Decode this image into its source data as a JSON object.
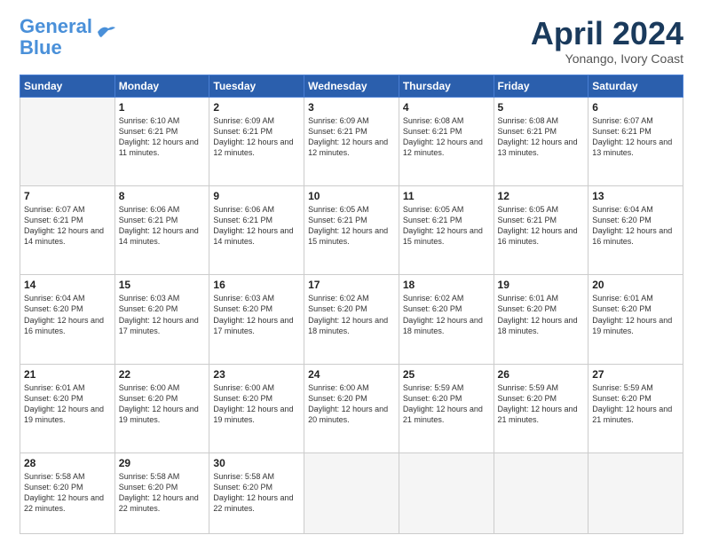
{
  "header": {
    "logo_line1": "General",
    "logo_line2": "Blue",
    "month": "April 2024",
    "location": "Yonango, Ivory Coast"
  },
  "weekdays": [
    "Sunday",
    "Monday",
    "Tuesday",
    "Wednesday",
    "Thursday",
    "Friday",
    "Saturday"
  ],
  "weeks": [
    [
      {
        "day": "",
        "empty": true
      },
      {
        "day": "1",
        "sunrise": "6:10 AM",
        "sunset": "6:21 PM",
        "daylight": "12 hours and 11 minutes."
      },
      {
        "day": "2",
        "sunrise": "6:09 AM",
        "sunset": "6:21 PM",
        "daylight": "12 hours and 12 minutes."
      },
      {
        "day": "3",
        "sunrise": "6:09 AM",
        "sunset": "6:21 PM",
        "daylight": "12 hours and 12 minutes."
      },
      {
        "day": "4",
        "sunrise": "6:08 AM",
        "sunset": "6:21 PM",
        "daylight": "12 hours and 12 minutes."
      },
      {
        "day": "5",
        "sunrise": "6:08 AM",
        "sunset": "6:21 PM",
        "daylight": "12 hours and 13 minutes."
      },
      {
        "day": "6",
        "sunrise": "6:07 AM",
        "sunset": "6:21 PM",
        "daylight": "12 hours and 13 minutes."
      }
    ],
    [
      {
        "day": "7",
        "sunrise": "6:07 AM",
        "sunset": "6:21 PM",
        "daylight": "12 hours and 14 minutes."
      },
      {
        "day": "8",
        "sunrise": "6:06 AM",
        "sunset": "6:21 PM",
        "daylight": "12 hours and 14 minutes."
      },
      {
        "day": "9",
        "sunrise": "6:06 AM",
        "sunset": "6:21 PM",
        "daylight": "12 hours and 14 minutes."
      },
      {
        "day": "10",
        "sunrise": "6:05 AM",
        "sunset": "6:21 PM",
        "daylight": "12 hours and 15 minutes."
      },
      {
        "day": "11",
        "sunrise": "6:05 AM",
        "sunset": "6:21 PM",
        "daylight": "12 hours and 15 minutes."
      },
      {
        "day": "12",
        "sunrise": "6:05 AM",
        "sunset": "6:21 PM",
        "daylight": "12 hours and 16 minutes."
      },
      {
        "day": "13",
        "sunrise": "6:04 AM",
        "sunset": "6:20 PM",
        "daylight": "12 hours and 16 minutes."
      }
    ],
    [
      {
        "day": "14",
        "sunrise": "6:04 AM",
        "sunset": "6:20 PM",
        "daylight": "12 hours and 16 minutes."
      },
      {
        "day": "15",
        "sunrise": "6:03 AM",
        "sunset": "6:20 PM",
        "daylight": "12 hours and 17 minutes."
      },
      {
        "day": "16",
        "sunrise": "6:03 AM",
        "sunset": "6:20 PM",
        "daylight": "12 hours and 17 minutes."
      },
      {
        "day": "17",
        "sunrise": "6:02 AM",
        "sunset": "6:20 PM",
        "daylight": "12 hours and 18 minutes."
      },
      {
        "day": "18",
        "sunrise": "6:02 AM",
        "sunset": "6:20 PM",
        "daylight": "12 hours and 18 minutes."
      },
      {
        "day": "19",
        "sunrise": "6:01 AM",
        "sunset": "6:20 PM",
        "daylight": "12 hours and 18 minutes."
      },
      {
        "day": "20",
        "sunrise": "6:01 AM",
        "sunset": "6:20 PM",
        "daylight": "12 hours and 19 minutes."
      }
    ],
    [
      {
        "day": "21",
        "sunrise": "6:01 AM",
        "sunset": "6:20 PM",
        "daylight": "12 hours and 19 minutes."
      },
      {
        "day": "22",
        "sunrise": "6:00 AM",
        "sunset": "6:20 PM",
        "daylight": "12 hours and 19 minutes."
      },
      {
        "day": "23",
        "sunrise": "6:00 AM",
        "sunset": "6:20 PM",
        "daylight": "12 hours and 19 minutes."
      },
      {
        "day": "24",
        "sunrise": "6:00 AM",
        "sunset": "6:20 PM",
        "daylight": "12 hours and 20 minutes."
      },
      {
        "day": "25",
        "sunrise": "5:59 AM",
        "sunset": "6:20 PM",
        "daylight": "12 hours and 21 minutes."
      },
      {
        "day": "26",
        "sunrise": "5:59 AM",
        "sunset": "6:20 PM",
        "daylight": "12 hours and 21 minutes."
      },
      {
        "day": "27",
        "sunrise": "5:59 AM",
        "sunset": "6:20 PM",
        "daylight": "12 hours and 21 minutes."
      }
    ],
    [
      {
        "day": "28",
        "sunrise": "5:58 AM",
        "sunset": "6:20 PM",
        "daylight": "12 hours and 22 minutes."
      },
      {
        "day": "29",
        "sunrise": "5:58 AM",
        "sunset": "6:20 PM",
        "daylight": "12 hours and 22 minutes."
      },
      {
        "day": "30",
        "sunrise": "5:58 AM",
        "sunset": "6:20 PM",
        "daylight": "12 hours and 22 minutes."
      },
      {
        "day": "",
        "empty": true
      },
      {
        "day": "",
        "empty": true
      },
      {
        "day": "",
        "empty": true
      },
      {
        "day": "",
        "empty": true
      }
    ]
  ]
}
